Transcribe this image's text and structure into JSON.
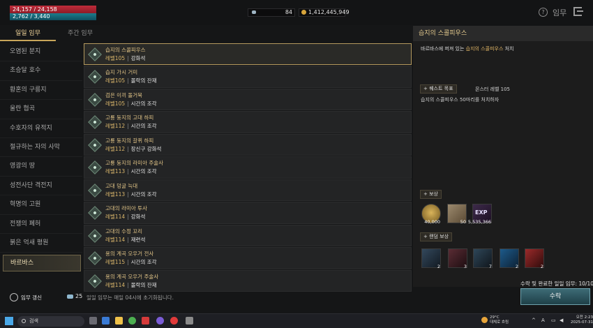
{
  "player": {
    "hp": "24,157 / 24,158",
    "mp": "2,762 / 3,440"
  },
  "currency": {
    "crystal": "84",
    "gold": "1,412,445,949"
  },
  "header": {
    "title": "임무",
    "help_icon": "?"
  },
  "tabs": [
    {
      "label": "일일 임무",
      "active": true
    },
    {
      "label": "주간 임무",
      "active": false
    }
  ],
  "regions": [
    "오염된 분지",
    "초승달 호수",
    "황혼의 구릉지",
    "울란 협곡",
    "수호자의 유적지",
    "절규하는 자의 사막",
    "영광의 땅",
    "성전사단 격전지",
    "혁명의 고원",
    "전쟁의 폐허",
    "붉은 억새 평원",
    "바르바스"
  ],
  "selected_region_index": 11,
  "quests": [
    {
      "name": "습지의 스콜피우스",
      "level": "레벨105",
      "reward": "강화석",
      "selected": true
    },
    {
      "name": "습지 가시 거미",
      "level": "레벨105",
      "reward": "몰락의 잔재"
    },
    {
      "name": "검은 이끼 돌거북",
      "level": "레벨105",
      "reward": "시간의 조각"
    },
    {
      "name": "고룡 둥지의 고대 하피",
      "level": "레벨112",
      "reward": "시간의 조각"
    },
    {
      "name": "고룡 둥지의 갈퀴 하피",
      "level": "레벨112",
      "reward": "장신구 강화석"
    },
    {
      "name": "고룡 둥지의 라미아 주술사",
      "level": "레벨113",
      "reward": "시간의 조각"
    },
    {
      "name": "고대 덩굴 늑대",
      "level": "레벨113",
      "reward": "시간의 조각"
    },
    {
      "name": "고대의 라미아 투사",
      "level": "레벨114",
      "reward": "강화석"
    },
    {
      "name": "고대의 수정 꼬리",
      "level": "레벨114",
      "reward": "재련석"
    },
    {
      "name": "용의 계곡 오우거 전사",
      "level": "레벨115",
      "reward": "시간의 조각"
    },
    {
      "name": "용의 계곡 오우거 주술사",
      "level": "레벨114",
      "reward": "몰락의 잔재"
    }
  ],
  "detail": {
    "title": "습지의 스콜피우스",
    "desc_prefix": "바르바스에 퍼져 있는 ",
    "desc_highlight": "습지의 스콜피우스",
    "desc_suffix": " 처치",
    "objective_label": "+ 퀘스트 목표",
    "monster_level": "몬스터 레벨 105",
    "objective_text": "습지의 스콜피우스 50마리를 처치하자",
    "reward_label": "+ 보상",
    "rewards": [
      {
        "icon": "gold-coin-icon",
        "count": "40,000"
      },
      {
        "icon": "scroll-icon",
        "count": "50"
      },
      {
        "icon": "exp-icon",
        "label": "EXP",
        "count": "5,535,366"
      }
    ],
    "random_reward_label": "+ 랜덤 보상",
    "random_rewards": [
      {
        "icon": "blue-crystal-icon",
        "count": "2"
      },
      {
        "icon": "red-ore-icon",
        "count": "3"
      },
      {
        "icon": "blue-ore-icon",
        "count": "7"
      },
      {
        "icon": "azure-gem-icon",
        "count": "2"
      },
      {
        "icon": "ruby-gem-icon",
        "count": "2"
      }
    ]
  },
  "footer": {
    "refresh_label": "임무 갱신",
    "ticket_count": "25",
    "reset_message": "일일 임무는 매일 04시에 초기화됩니다.",
    "completed_info": "수락 및 완료한 일일 임무: 10/10",
    "accept_label": "수락"
  },
  "taskbar": {
    "search_placeholder": "검색",
    "weather_temp": "29°C",
    "weather_desc": "대체로 흐림",
    "ime": "A",
    "time": "오전 2:23",
    "date": "2025-07-31"
  },
  "colors": {
    "accent_gold": "#e0c386",
    "accept_teal": "#3d6b75",
    "hp_red": "#c02c3a",
    "mp_teal": "#1c7c8c"
  }
}
